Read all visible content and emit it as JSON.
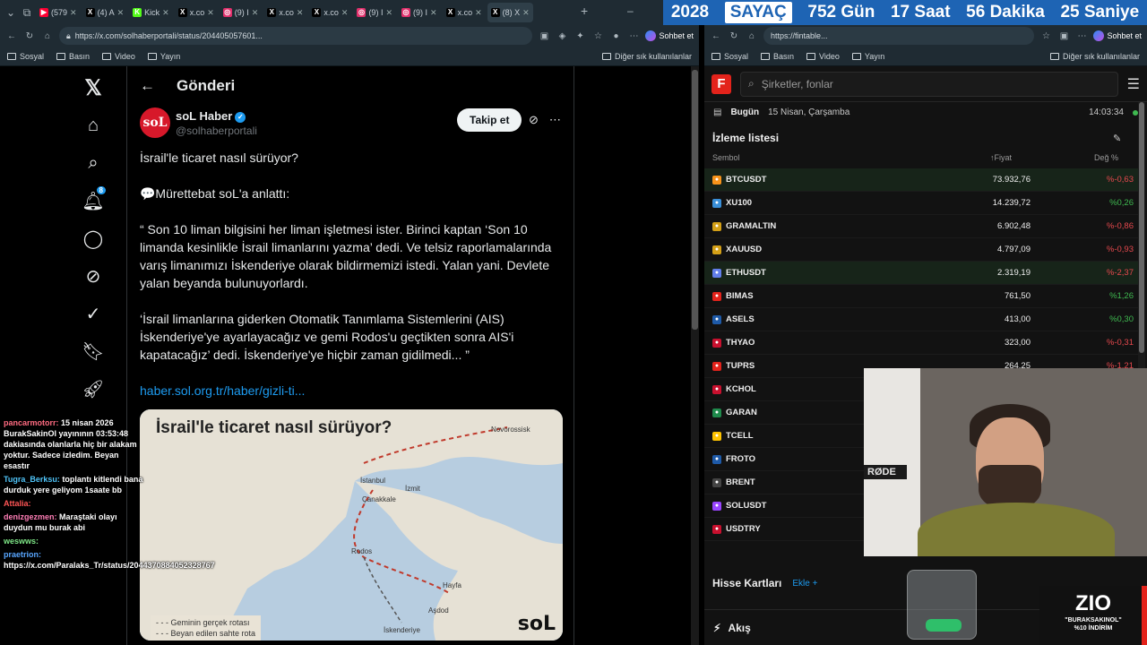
{
  "browser_left": {
    "tabs": [
      {
        "label": "(579",
        "color": "#ff0033",
        "glyph": "▶"
      },
      {
        "label": "(4) A",
        "color": "#000000",
        "glyph": "X"
      },
      {
        "label": "Kick",
        "color": "#53fc18",
        "glyph": "K"
      },
      {
        "label": "x.co",
        "color": "#000000",
        "glyph": "X"
      },
      {
        "label": "(9) I",
        "color": "#e1306c",
        "glyph": "◎"
      },
      {
        "label": "x.co",
        "color": "#000000",
        "glyph": "X"
      },
      {
        "label": "x.co",
        "color": "#000000",
        "glyph": "X"
      },
      {
        "label": "(9) I",
        "color": "#e1306c",
        "glyph": "◎"
      },
      {
        "label": "(9) I",
        "color": "#e1306c",
        "glyph": "◎"
      },
      {
        "label": "x.co",
        "color": "#000000",
        "glyph": "X"
      },
      {
        "label": "(8) X",
        "color": "#000000",
        "glyph": "X"
      }
    ],
    "url": "https://x.com/solhaberportali/status/204405057601...",
    "chat_label": "Sohbet et",
    "bookmarks": [
      "Sosyal",
      "Basın",
      "Video",
      "Yayın"
    ],
    "other_bookmarks": "Diğer sık kullanılanlar"
  },
  "counter": {
    "year": "2028",
    "label": "SAYAÇ",
    "days": "752 Gün",
    "hours": "17 Saat",
    "minutes": "56 Dakika",
    "seconds": "25 Saniye"
  },
  "browser_right": {
    "url": "https://fintable...",
    "chat_label": "Sohbet et",
    "bookmarks": [
      "Sosyal",
      "Basın",
      "Video",
      "Yayın"
    ],
    "other_bookmarks": "Diğer sık kullanılanlar"
  },
  "x": {
    "nav_badge": "8",
    "header_title": "Gönderi",
    "avatar_text": "soL",
    "display_name": "soL Haber",
    "handle": "@solhaberportali",
    "follow_label": "Takip et",
    "tweet": {
      "p1": "İsrail'le ticaret nasıl sürüyor?",
      "p2": "💬Mürettebat soL'a anlattı:",
      "p3": "“ Son 10 liman bilgisini her liman işletmesi ister. Birinci kaptan ‘Son 10 limanda kesinlikle İsrail limanlarını yazma’ dedi. Ve telsiz raporlamalarında varış limanımızı İskenderiye olarak bildirmemizi istedi. Yalan yani. Devlete yalan beyanda bulunuyorlardı.",
      "p4": "‘İsrail limanlarına giderken Otomatik Tanımlama Sistemlerini (AIS) İskenderiye'ye ayarlayacağız ve gemi Rodos'u geçtikten sonra AIS'i kapatacağız’ dedi. İskenderiye'ye hiçbir zaman gidilmedi... ”",
      "link": "haber.sol.org.tr/haber/gizli-ti..."
    },
    "map": {
      "title": "İsrail'le ticaret nasıl sürüyor?",
      "places": [
        "Novorossisk",
        "İstanbul",
        "İzmit",
        "Çanakkale",
        "Rodos",
        "Hayfa",
        "Aşdod",
        "İskenderiye"
      ],
      "legend1": "Geminin gerçek rotası",
      "legend2": "Beyan edilen sahte rota",
      "brand": "soL"
    }
  },
  "chat": [
    {
      "user": "pancarmotorr:",
      "user_color": "#ff6b81",
      "text": "15 nisan 2026 BurakSakinOl yayınının 03:53:48 dakiasında olanlarla hiç bir alakam yoktur. Sadece izledim. Beyan esastır"
    },
    {
      "user": "Tugra_Berksu:",
      "user_color": "#4fc3f7",
      "text": "toplantı kitlendi bana durduk yere geliyom 1saate bb"
    },
    {
      "user": "Attalia:",
      "user_color": "#ff5555",
      "text": ""
    },
    {
      "user": "denizgezmen:",
      "user_color": "#ff7eb6",
      "text": "Maraştaki olayı duydun mu burak abi"
    },
    {
      "user": "weswws:",
      "user_color": "#7ee787",
      "text": ""
    },
    {
      "user": "praetrion:",
      "user_color": "#58a6ff",
      "text": "https://x.com/Paralaks_Tr/status/2044370884052328767"
    }
  ],
  "fintables": {
    "logo": "F",
    "search_placeholder": "Şirketler, fonlar",
    "today_label": "Bugün",
    "date": "15 Nisan, Çarşamba",
    "time": "14:03:34",
    "watchlist_title": "İzleme listesi",
    "col_symbol": "Sembol",
    "col_price": "↑Fiyat",
    "col_change": "Değ %",
    "rows": [
      {
        "sym": "BTCUSDT",
        "price": "73.932,76",
        "chg": "%-0,63",
        "dir": "neg",
        "color": "#f7931a"
      },
      {
        "sym": "XU100",
        "price": "14.239,72",
        "chg": "%0,26",
        "dir": "pos",
        "color": "#3a8fd8"
      },
      {
        "sym": "GRAMALTIN",
        "price": "6.902,48",
        "chg": "%-0,86",
        "dir": "neg",
        "color": "#d4a017"
      },
      {
        "sym": "XAUUSD",
        "price": "4.797,09",
        "chg": "%-0,93",
        "dir": "neg",
        "color": "#d4a017"
      },
      {
        "sym": "ETHUSDT",
        "price": "2.319,19",
        "chg": "%-2,37",
        "dir": "neg",
        "color": "#627eea"
      },
      {
        "sym": "BIMAS",
        "price": "761,50",
        "chg": "%1,26",
        "dir": "pos",
        "color": "#e3231b"
      },
      {
        "sym": "ASELS",
        "price": "413,00",
        "chg": "%0,30",
        "dir": "pos",
        "color": "#1e5aa8"
      },
      {
        "sym": "THYAO",
        "price": "323,00",
        "chg": "%-0,31",
        "dir": "neg",
        "color": "#c8102e"
      },
      {
        "sym": "TUPRS",
        "price": "264,25",
        "chg": "%-1,21",
        "dir": "neg",
        "color": "#e3231b"
      },
      {
        "sym": "KCHOL",
        "price": "",
        "chg": "",
        "dir": "neg",
        "color": "#c8102e"
      },
      {
        "sym": "GARAN",
        "price": "",
        "chg": "",
        "dir": "pos",
        "color": "#1f8a4c"
      },
      {
        "sym": "TCELL",
        "price": "",
        "chg": "",
        "dir": "pos",
        "color": "#ffc300"
      },
      {
        "sym": "FROTO",
        "price": "",
        "chg": "",
        "dir": "pos",
        "color": "#1e5aa8"
      },
      {
        "sym": "BRENT",
        "price": "",
        "chg": "",
        "dir": "pos",
        "color": "#444444"
      },
      {
        "sym": "SOLUSDT",
        "price": "",
        "chg": "",
        "dir": "pos",
        "color": "#9945ff"
      },
      {
        "sym": "USDTRY",
        "price": "",
        "chg": "",
        "dir": "pos",
        "color": "#c8102e"
      }
    ],
    "cards_title": "Hisse Kartları",
    "cards_add": "Ekle",
    "flow_label": "Akış"
  },
  "webcam": {
    "mic_brand": "RØDE"
  },
  "promo": {
    "logo": "ZIO",
    "line1": "\"BURAKSAKINOL\"",
    "line2": "%10 İNDİRİM"
  }
}
